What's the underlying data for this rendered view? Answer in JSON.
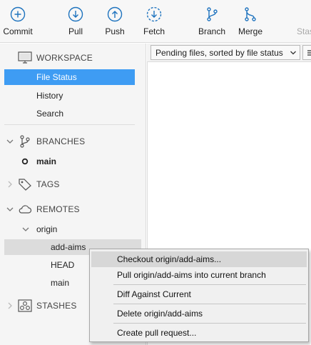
{
  "toolbar": {
    "commit": "Commit",
    "pull": "Pull",
    "push": "Push",
    "fetch": "Fetch",
    "branch": "Branch",
    "merge": "Merge",
    "stash": "Stas"
  },
  "sidebar": {
    "workspace": {
      "title": "WORKSPACE",
      "items": [
        "File Status",
        "History",
        "Search"
      ]
    },
    "branches": {
      "title": "BRANCHES",
      "items": [
        "main"
      ]
    },
    "tags": {
      "title": "TAGS"
    },
    "remotes": {
      "title": "REMOTES",
      "origin": "origin",
      "items": [
        "add-aims",
        "HEAD",
        "main"
      ]
    },
    "stashes": {
      "title": "STASHES"
    }
  },
  "file_view": {
    "filter_label": "Pending files, sorted by file status"
  },
  "context_menu": {
    "items": [
      "Checkout origin/add-aims...",
      "Pull origin/add-aims into current branch",
      "Diff Against Current",
      "Delete origin/add-aims",
      "Create pull request..."
    ]
  },
  "colors": {
    "selection": "#3e9cf3",
    "icon_blue": "#1e73be"
  }
}
